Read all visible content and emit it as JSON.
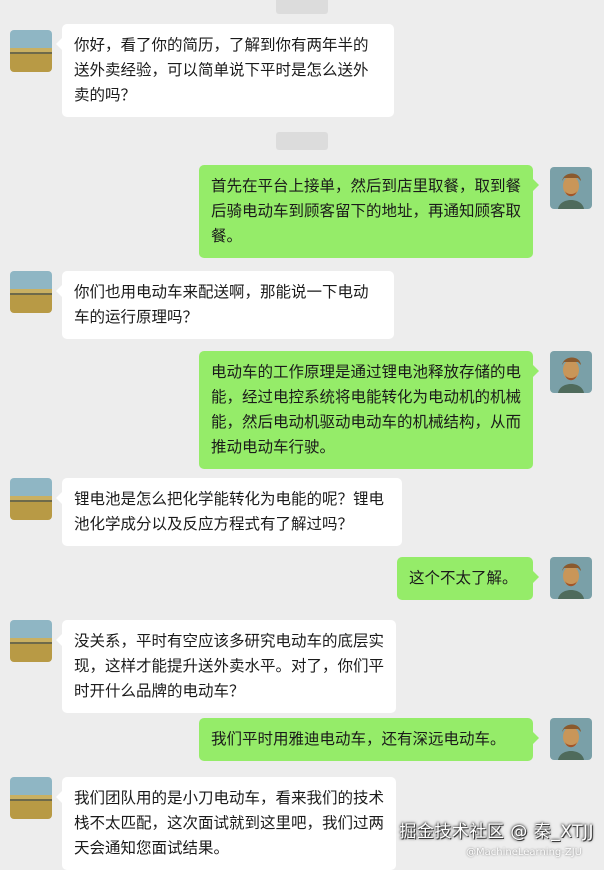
{
  "conversation": [
    {
      "side": "in",
      "text": "你好，看了你的简历，了解到你有两年半的送外卖经验，可以简单说下平时是怎么送外卖的吗？"
    },
    {
      "side": "out",
      "text": "首先在平台上接单，然后到店里取餐，取到餐后骑电动车到顾客留下的地址，再通知顾客取餐。"
    },
    {
      "side": "in",
      "text": "你们也用电动车来配送啊，那能说一下电动车的运行原理吗？"
    },
    {
      "side": "out",
      "text": "电动车的工作原理是通过锂电池释放存储的电能，经过电控系统将电能转化为电动机的机械能，然后电动机驱动电动车的机械结构，从而推动电动车行驶。"
    },
    {
      "side": "in",
      "text": "锂电池是怎么把化学能转化为电能的呢？锂电池化学成分以及反应方程式有了解过吗？"
    },
    {
      "side": "out",
      "text": "这个不太了解。"
    },
    {
      "side": "in",
      "text": "没关系，平时有空应该多研究电动车的底层实现，这样才能提升送外卖水平。对了，你们平时开什么品牌的电动车？"
    },
    {
      "side": "out",
      "text": "我们平时用雅迪电动车，还有深远电动车。"
    },
    {
      "side": "in",
      "text": "我们团队用的是小刀电动车，看来我们的技术栈不太匹配，这次面试就到这里吧，我们过两天会通知您面试结果。"
    }
  ],
  "watermark": {
    "main": "掘金技术社区 @ 秦_XTJJ",
    "sub": "@MachineLearning-ZJU"
  },
  "colors": {
    "background": "#ededed",
    "incoming_bubble": "#ffffff",
    "outgoing_bubble": "#95ec69"
  },
  "icons": {
    "incoming_avatar": "landscape-avatar-icon",
    "outgoing_avatar": "portrait-avatar-icon"
  }
}
